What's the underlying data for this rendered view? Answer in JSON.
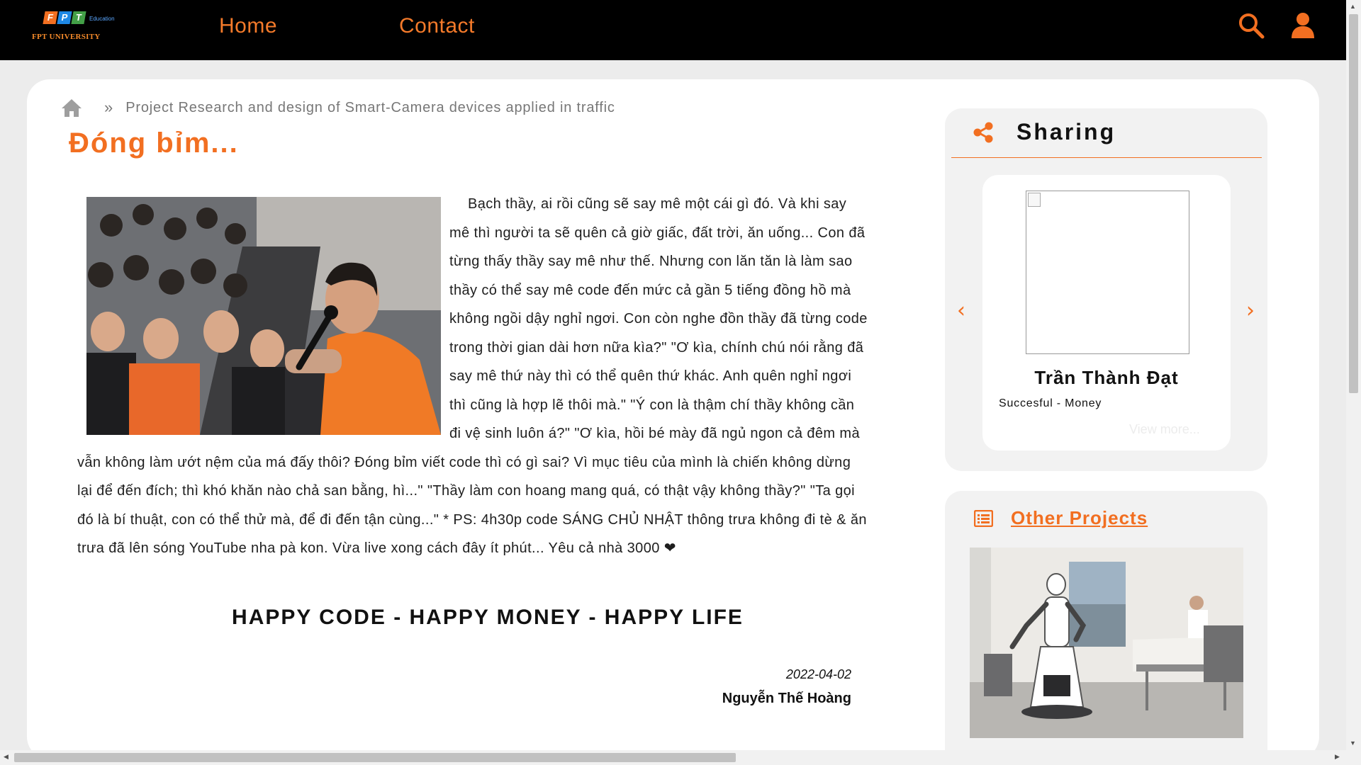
{
  "brand": {
    "logo_letters": [
      "F",
      "P",
      "T"
    ],
    "logo_sub": "Education",
    "logo_name": "FPT UNIVERSITY",
    "accent_color": "#f26f21"
  },
  "nav": {
    "home": "Home",
    "contact": "Contact",
    "icons": [
      "search-icon",
      "user-icon"
    ]
  },
  "breadcrumb": {
    "separator": "»",
    "current": "Project Research and design of Smart-Camera devices applied in traffic"
  },
  "article": {
    "title": "Đóng bỉm...",
    "body": "Bạch thầy, ai rồi cũng sẽ say mê một cái gì đó. Và khi say mê thì người ta sẽ quên cả giờ giấc, đất trời, ăn uống... Con đã từng thấy thầy say mê như thế. Nhưng con lăn tăn là làm sao thầy có thể say mê code đến mức cả gần 5 tiếng đồng hồ mà không ngồi dậy nghỉ ngơi. Con còn nghe đồn thầy đã từng code trong thời gian dài hơn nữa kìa?\" \"Ơ kìa, chính chú nói rằng đã say mê thứ này thì có thể quên thứ khác. Anh quên nghỉ ngơi thì cũng là hợp lẽ thôi mà.\" \"Ý con là thậm chí thầy không cần đi vệ sinh luôn á?\" \"Ơ kìa, hồi bé mày đã ngủ ngon cả đêm mà vẫn không làm ướt nệm của má đấy thôi? Đóng bỉm viết code thì có gì sai? Vì mục tiêu của mình là chiến không dừng lại để đến đích; thì khó khăn nào chả san bằng, hì...\" \"Thầy làm con hoang mang quá, có thật vậy không thầy?\" \"Ta gọi đó là bí thuật, con có thể thử mà, để đi đến tận cùng...\" * PS: 4h30p code SÁNG CHỦ NHẬT thông trưa không đi tè & ăn trưa đã lên sóng YouTube nha pà kon. Vừa live xong cách đây ít phút... Yêu cả nhà 3000 ❤",
    "slogan": "HAPPY CODE - HAPPY MONEY - HAPPY LIFE",
    "date": "2022-04-02",
    "author": "Nguyễn Thế Hoàng"
  },
  "sharing": {
    "title": "Sharing",
    "person_name": "Trần Thành Đạt",
    "person_role": "Succesful - Money",
    "view_more": "View more...",
    "prev": "‹",
    "next": "›"
  },
  "other_projects": {
    "title": "Other Projects"
  }
}
